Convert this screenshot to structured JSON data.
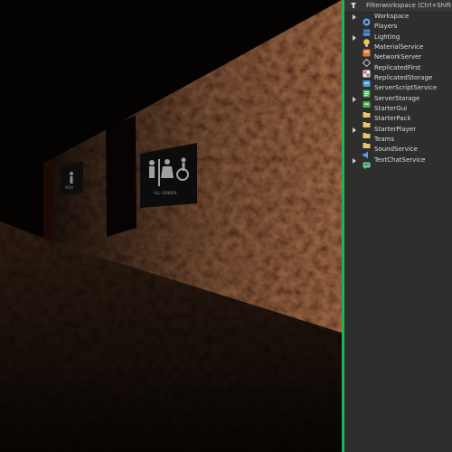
{
  "viewport": {
    "sign_near_text": "ALL GENDER",
    "sign_far_text": "MEN"
  },
  "explorer": {
    "filter_placeholder": "Filterworkspace (Ctrl+Shift+X)",
    "items": [
      {
        "label": "Workspace",
        "icon": "workspace-icon",
        "expandable": true,
        "color": "#5aa3e8"
      },
      {
        "label": "Players",
        "icon": "players-icon",
        "expandable": false,
        "color": "#4a8fd8"
      },
      {
        "label": "Lighting",
        "icon": "lightbulb-icon",
        "expandable": true,
        "color": "#f2c94c"
      },
      {
        "label": "MaterialService",
        "icon": "material-service-icon",
        "expandable": false,
        "color": "#e07a3a"
      },
      {
        "label": "NetworkServer",
        "icon": "network-server-icon",
        "expandable": false,
        "color": "#bdbdbd"
      },
      {
        "label": "ReplicatedFirst",
        "icon": "replicated-first-icon",
        "expandable": false,
        "color": "#e05a5a"
      },
      {
        "label": "ReplicatedStorage",
        "icon": "replicated-storage-icon",
        "expandable": false,
        "color": "#4aa0e0"
      },
      {
        "label": "ServerScriptService",
        "icon": "server-script-service-icon",
        "expandable": false,
        "color": "#4caf50"
      },
      {
        "label": "ServerStorage",
        "icon": "server-storage-icon",
        "expandable": true,
        "color": "#4caf50"
      },
      {
        "label": "StarterGui",
        "icon": "starter-gui-folder-icon",
        "expandable": false,
        "color": "#e9c46a"
      },
      {
        "label": "StarterPack",
        "icon": "starter-pack-folder-icon",
        "expandable": false,
        "color": "#e9c46a"
      },
      {
        "label": "StarterPlayer",
        "icon": "starter-player-folder-icon",
        "expandable": true,
        "color": "#e9c46a"
      },
      {
        "label": "Teams",
        "icon": "teams-folder-icon",
        "expandable": false,
        "color": "#e9c46a"
      },
      {
        "label": "SoundService",
        "icon": "speaker-icon",
        "expandable": false,
        "color": "#5aa3e8"
      },
      {
        "label": "TextChatService",
        "icon": "text-chat-icon",
        "expandable": true,
        "color": "#6fcf97"
      }
    ]
  }
}
